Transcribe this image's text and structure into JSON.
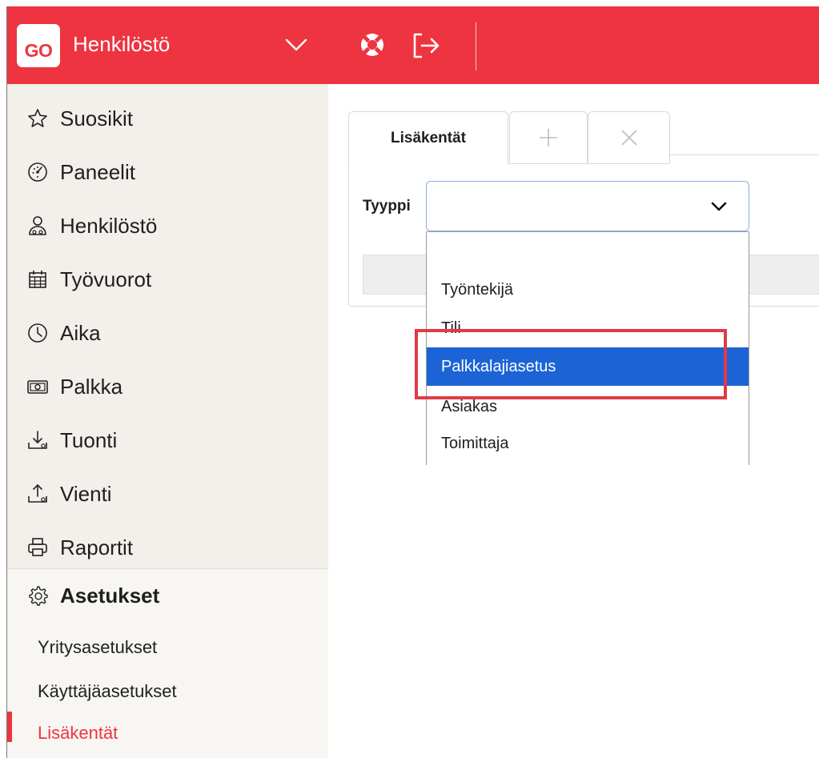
{
  "header": {
    "logo_text": "GO",
    "app_title": "Henkilöstö",
    "brand_color": "#ee3440"
  },
  "sidebar": {
    "items": [
      {
        "label": "Suosikit",
        "icon": "star-icon"
      },
      {
        "label": "Paneelit",
        "icon": "gauge-icon"
      },
      {
        "label": "Henkilöstö",
        "icon": "people-icon"
      },
      {
        "label": "Työvuorot",
        "icon": "calendar-icon"
      },
      {
        "label": "Aika",
        "icon": "clock-icon"
      },
      {
        "label": "Palkka",
        "icon": "money-icon"
      },
      {
        "label": "Tuonti",
        "icon": "import-icon"
      },
      {
        "label": "Vienti",
        "icon": "export-icon"
      },
      {
        "label": "Raportit",
        "icon": "printer-icon"
      }
    ],
    "settings": {
      "label": "Asetukset",
      "icon": "gear-icon",
      "sub_items": [
        {
          "label": "Yritysasetukset",
          "active": false
        },
        {
          "label": "Käyttäjäasetukset",
          "active": false
        },
        {
          "label": "Lisäkentät",
          "active": true
        }
      ]
    }
  },
  "main": {
    "tabs": {
      "active_label": "Lisäkentät",
      "add_icon": "plus-icon",
      "close_icon": "close-icon"
    },
    "type_field": {
      "label": "Tyyppi",
      "value": ""
    },
    "dropdown": {
      "options": [
        "",
        "Työntekijä",
        "Tili",
        "Palkkalajiasetus",
        "Asiakas",
        "Toimittaja"
      ],
      "selected": "Palkkalajiasetus",
      "selected_color": "#1c64d6"
    }
  }
}
